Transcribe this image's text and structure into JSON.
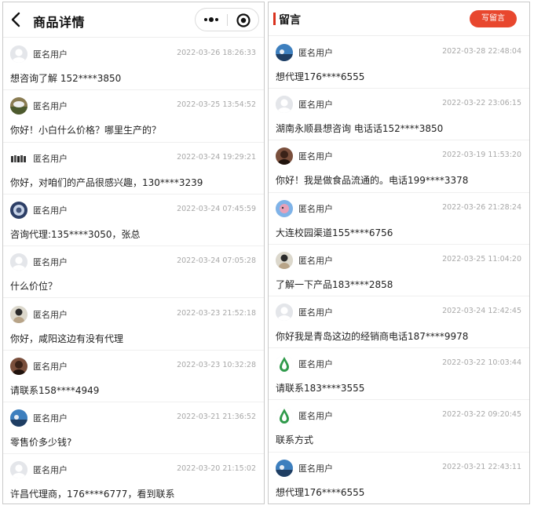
{
  "left": {
    "title": "商品详情",
    "comments": [
      {
        "name": "匿名用户",
        "date": "2022-03-26 18:26:33",
        "text": "想咨询了解 152****3850",
        "avatar": "default"
      },
      {
        "name": "匿名用户",
        "date": "2022-03-25 13:54:52",
        "text": "你好！小白什么价格？哪里生产的？",
        "avatar": "photo-green"
      },
      {
        "name": "匿名用户",
        "date": "2022-03-24 19:29:21",
        "text": "你好，对咱们的产品很感兴趣，130****3239",
        "avatar": "group-photo"
      },
      {
        "name": "匿名用户",
        "date": "2022-03-24 07:45:59",
        "text": "咨询代理:135****3050，张总",
        "avatar": "photo-blue"
      },
      {
        "name": "匿名用户",
        "date": "2022-03-24 07:05:28",
        "text": "什么价位？",
        "avatar": "default"
      },
      {
        "name": "匿名用户",
        "date": "2022-03-23 21:52:18",
        "text": "你好，咸阳这边有没有代理",
        "avatar": "photo-portrait"
      },
      {
        "name": "匿名用户",
        "date": "2022-03-23 10:32:28",
        "text": "请联系158****4949",
        "avatar": "photo-dark"
      },
      {
        "name": "匿名用户",
        "date": "2022-03-21 21:36:52",
        "text": "零售价多少钱?",
        "avatar": "photo-sky"
      },
      {
        "name": "匿名用户",
        "date": "2022-03-20 21:15:02",
        "text": "许昌代理商，176****6777，看到联系",
        "avatar": "default"
      }
    ]
  },
  "right": {
    "title": "留言",
    "write_button": "写留言",
    "comments": [
      {
        "name": "匿名用户",
        "date": "2022-03-28 22:48:04",
        "text": "想代理176****6555",
        "avatar": "photo-sky"
      },
      {
        "name": "匿名用户",
        "date": "2022-03-22 23:06:15",
        "text": "湖南永顺县想咨询 电话话152****3850",
        "avatar": "default"
      },
      {
        "name": "匿名用户",
        "date": "2022-03-19 11:53:20",
        "text": "你好！我是做食品流通的。电话199****3378",
        "avatar": "photo-dark"
      },
      {
        "name": "匿名用户",
        "date": "2022-03-26 21:28:24",
        "text": "大连校园渠道155****6756",
        "avatar": "photo-anime"
      },
      {
        "name": "匿名用户",
        "date": "2022-03-25 11:04:20",
        "text": "了解一下产品183****2858",
        "avatar": "photo-portrait"
      },
      {
        "name": "匿名用户",
        "date": "2022-03-24 12:42:45",
        "text": "你好我是青岛这边的经销商电话187****9978",
        "avatar": "default"
      },
      {
        "name": "匿名用户",
        "date": "2022-03-22 10:03:44",
        "text": "请联系183****3555",
        "avatar": "logo-drop"
      },
      {
        "name": "匿名用户",
        "date": "2022-03-22 09:20:45",
        "text": "联系方式",
        "avatar": "logo-drop"
      },
      {
        "name": "匿名用户",
        "date": "2022-03-21 22:43:11",
        "text": "想代理176****6555",
        "avatar": "photo-sky"
      }
    ]
  },
  "icons": {
    "back": "back-arrow-icon",
    "more": "more-dots-icon",
    "target": "target-circle-icon"
  },
  "colors": {
    "accent": "#e8472e",
    "title_bar": "#d9321e",
    "date": "#a8a8a8"
  }
}
